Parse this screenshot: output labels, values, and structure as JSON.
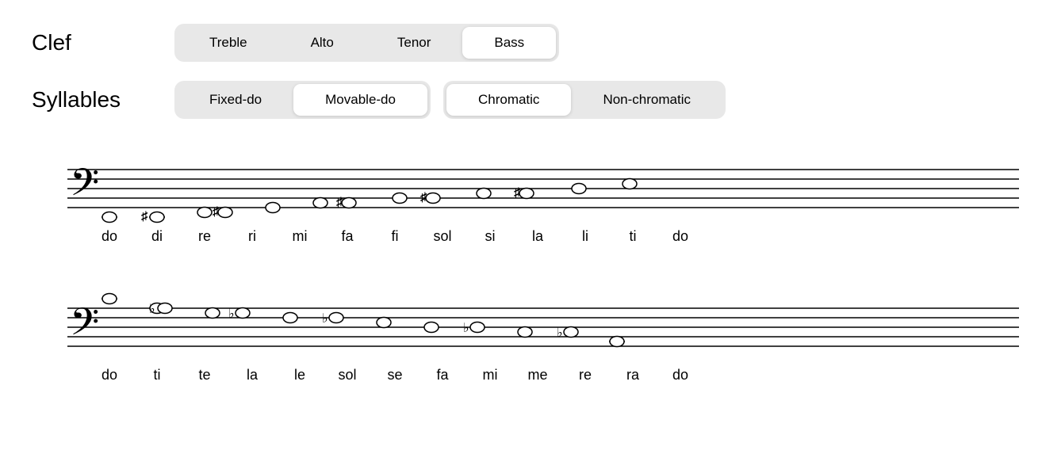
{
  "clef": {
    "label": "Clef",
    "buttons": [
      {
        "id": "treble",
        "label": "Treble",
        "active": false
      },
      {
        "id": "alto",
        "label": "Alto",
        "active": false
      },
      {
        "id": "tenor",
        "label": "Tenor",
        "active": false
      },
      {
        "id": "bass",
        "label": "Bass",
        "active": true
      }
    ]
  },
  "syllables": {
    "label": "Syllables",
    "group1": [
      {
        "id": "fixed-do",
        "label": "Fixed-do",
        "active": false
      },
      {
        "id": "movable-do",
        "label": "Movable-do",
        "active": true
      }
    ],
    "group2": [
      {
        "id": "chromatic",
        "label": "Chromatic",
        "active": true
      },
      {
        "id": "non-chromatic",
        "label": "Non-chromatic",
        "active": false
      }
    ]
  },
  "ascending": {
    "syllables": [
      "do",
      "di",
      "re",
      "ri",
      "mi",
      "fa",
      "fi",
      "sol",
      "si",
      "la",
      "li",
      "ti",
      "do"
    ]
  },
  "descending": {
    "syllables": [
      "do",
      "ti",
      "te",
      "la",
      "le",
      "sol",
      "se",
      "fa",
      "mi",
      "me",
      "re",
      "ra",
      "do"
    ]
  }
}
